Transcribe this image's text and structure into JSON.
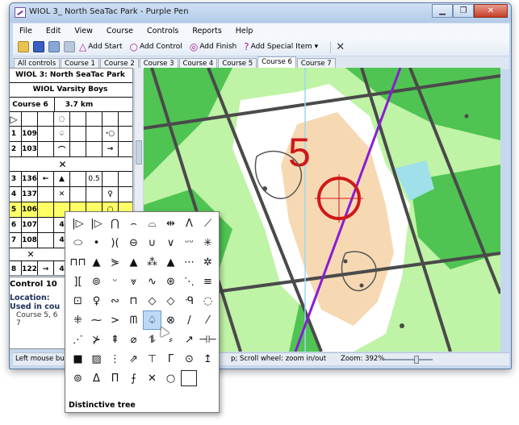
{
  "window": {
    "title": "WIOL 3_ North SeaTac Park - Purple Pen"
  },
  "window_buttons": [
    "▁",
    "❐",
    "✕"
  ],
  "menu": [
    "File",
    "Edit",
    "View",
    "Course",
    "Controls",
    "Reports",
    "Help"
  ],
  "toolbar": {
    "add_start": "Add Start",
    "add_control": "Add Control",
    "add_finish": "Add Finish",
    "add_special": "Add Special Item",
    "add_special_arrow": "▾",
    "glyph_start": "△",
    "glyph_control": "○",
    "glyph_finish": "◎",
    "glyph_special": "?",
    "delete_glyph": "✕"
  },
  "tabs": [
    "All controls",
    "Course 1",
    "Course 2",
    "Course 3",
    "Course 4",
    "Course 5",
    "Course 6",
    "Course 7"
  ],
  "active_tab": "Course 6",
  "description": {
    "event": "WIOL 3: North SeaTac Park",
    "class": "WIOL Varsity Boys",
    "course": "Course 6",
    "length": "3.7 km",
    "start_symbol": "▷",
    "start_extra": "◌",
    "rows": [
      {
        "num": "1",
        "code": "109",
        "c": "♤",
        "g": "·○"
      },
      {
        "num": "2",
        "code": "103",
        "c": "⌒",
        "g": "→"
      },
      {
        "num": "3",
        "code": "136",
        "b": "←",
        "c": "▲",
        "e": "0.5"
      },
      {
        "num": "4",
        "code": "137",
        "c": "✕",
        "g": "♀"
      },
      {
        "num": "5",
        "code": "106",
        "c": "",
        "g": "○"
      },
      {
        "num": "6",
        "code": "107",
        "c": "4",
        "g": ""
      },
      {
        "num": "7",
        "code": "108",
        "c": "4",
        "g": ""
      },
      {
        "num": "8",
        "code": "122",
        "b": "→",
        "c": "4",
        "g": ""
      }
    ],
    "crossing_marker": "✕"
  },
  "control_info": {
    "title": "Control 10",
    "location_label": "Location:",
    "used_label": "Used in cou",
    "used_text": "Course 5, 6",
    "used_text2": "7"
  },
  "map": {
    "course_number": "5",
    "colors": {
      "course": "#d01818",
      "leg": "#8a1ad6",
      "green": "#4fc452",
      "light_green": "#bff3a6",
      "open": "#f6d9b3"
    }
  },
  "status": {
    "left": "Left mouse butt",
    "mid": "p; Scroll wheel: zoom in/out",
    "zoom": "Zoom: 392%",
    "zoom_percent": 67
  },
  "symbol_palette": {
    "rows": [
      [
        "|▷",
        "|▷",
        "⋂",
        "⌢",
        "⌓",
        "⇹",
        "Λ",
        "⟋"
      ],
      [
        "⬭",
        "•",
        ")(",
        "⊖",
        "∪",
        "∨",
        "ᵕᵕ",
        "✳"
      ],
      [
        "⊓⊓",
        "▲",
        "⋟",
        "▲",
        "⁂",
        "▲",
        "⋯",
        "✲"
      ],
      [
        "][",
        "⊚",
        "ᵕ",
        "⩔",
        "∿",
        "⊛",
        "⋱",
        "≡"
      ],
      [
        "⊡",
        "♀",
        "∾",
        "⊓",
        "◇",
        "◇",
        "ᑴ",
        "◌"
      ],
      [
        "⁜",
        "⁓",
        ">",
        "ᗰ",
        "♤",
        "⊗",
        "/",
        "⁄"
      ],
      [
        "⋰",
        "⊁",
        "⇞",
        "⌀",
        "⥮",
        "⸗",
        "↗",
        "⊣⊢"
      ],
      [
        "■",
        "▨",
        "⋮",
        "⇗",
        "⊤",
        "Γ",
        "⊙",
        "↥"
      ],
      [
        "⊚",
        "Δ",
        "Π",
        "⨍",
        "✕",
        "○",
        ""
      ]
    ],
    "selected": "♤",
    "caption": "Distinctive tree"
  }
}
